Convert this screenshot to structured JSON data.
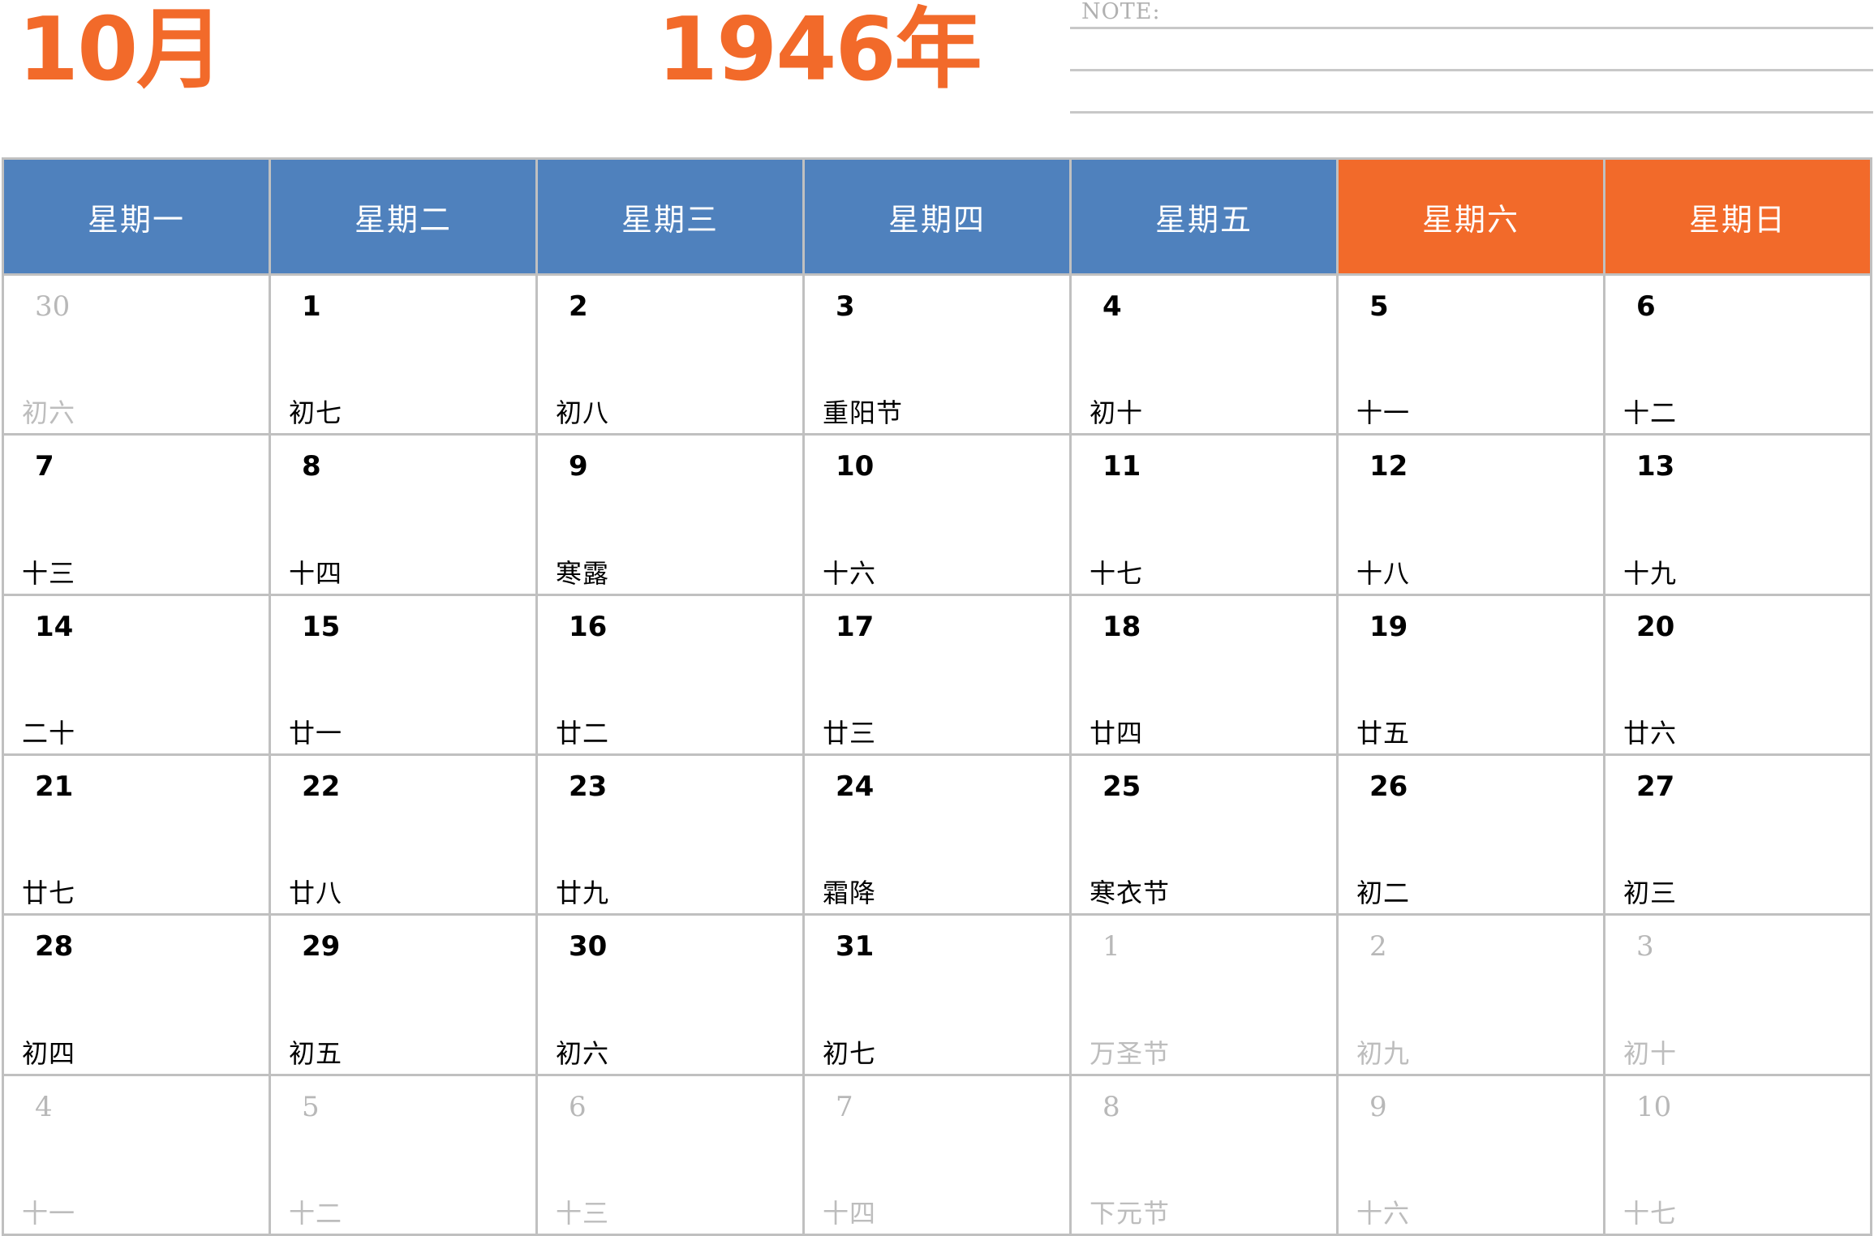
{
  "header": {
    "month": "10月",
    "year": "1946年",
    "note_label": "NOTE:"
  },
  "colors": {
    "accent": "#f26a2a",
    "weekday_header": "#4f81bd",
    "weekend_header": "#f26a2a",
    "muted_text": "#b8b8b8",
    "grid_line": "#c0c0c0"
  },
  "weekdays": [
    "星期一",
    "星期二",
    "星期三",
    "星期四",
    "星期五",
    "星期六",
    "星期日"
  ],
  "weeks": [
    [
      {
        "day": "30",
        "lunar": "初六",
        "muted": true
      },
      {
        "day": "1",
        "lunar": "初七",
        "muted": false
      },
      {
        "day": "2",
        "lunar": "初八",
        "muted": false
      },
      {
        "day": "3",
        "lunar": "重阳节",
        "muted": false
      },
      {
        "day": "4",
        "lunar": "初十",
        "muted": false
      },
      {
        "day": "5",
        "lunar": "十一",
        "muted": false
      },
      {
        "day": "6",
        "lunar": "十二",
        "muted": false
      }
    ],
    [
      {
        "day": "7",
        "lunar": "十三",
        "muted": false
      },
      {
        "day": "8",
        "lunar": "十四",
        "muted": false
      },
      {
        "day": "9",
        "lunar": "寒露",
        "muted": false
      },
      {
        "day": "10",
        "lunar": "十六",
        "muted": false
      },
      {
        "day": "11",
        "lunar": "十七",
        "muted": false
      },
      {
        "day": "12",
        "lunar": "十八",
        "muted": false
      },
      {
        "day": "13",
        "lunar": "十九",
        "muted": false
      }
    ],
    [
      {
        "day": "14",
        "lunar": "二十",
        "muted": false
      },
      {
        "day": "15",
        "lunar": "廿一",
        "muted": false
      },
      {
        "day": "16",
        "lunar": "廿二",
        "muted": false
      },
      {
        "day": "17",
        "lunar": "廿三",
        "muted": false
      },
      {
        "day": "18",
        "lunar": "廿四",
        "muted": false
      },
      {
        "day": "19",
        "lunar": "廿五",
        "muted": false
      },
      {
        "day": "20",
        "lunar": "廿六",
        "muted": false
      }
    ],
    [
      {
        "day": "21",
        "lunar": "廿七",
        "muted": false
      },
      {
        "day": "22",
        "lunar": "廿八",
        "muted": false
      },
      {
        "day": "23",
        "lunar": "廿九",
        "muted": false
      },
      {
        "day": "24",
        "lunar": "霜降",
        "muted": false
      },
      {
        "day": "25",
        "lunar": "寒衣节",
        "muted": false
      },
      {
        "day": "26",
        "lunar": "初二",
        "muted": false
      },
      {
        "day": "27",
        "lunar": "初三",
        "muted": false
      }
    ],
    [
      {
        "day": "28",
        "lunar": "初四",
        "muted": false
      },
      {
        "day": "29",
        "lunar": "初五",
        "muted": false
      },
      {
        "day": "30",
        "lunar": "初六",
        "muted": false
      },
      {
        "day": "31",
        "lunar": "初七",
        "muted": false
      },
      {
        "day": "1",
        "lunar": "万圣节",
        "muted": true
      },
      {
        "day": "2",
        "lunar": "初九",
        "muted": true
      },
      {
        "day": "3",
        "lunar": "初十",
        "muted": true
      }
    ],
    [
      {
        "day": "4",
        "lunar": "十一",
        "muted": true
      },
      {
        "day": "5",
        "lunar": "十二",
        "muted": true
      },
      {
        "day": "6",
        "lunar": "十三",
        "muted": true
      },
      {
        "day": "7",
        "lunar": "十四",
        "muted": true
      },
      {
        "day": "8",
        "lunar": "下元节",
        "muted": true
      },
      {
        "day": "9",
        "lunar": "十六",
        "muted": true
      },
      {
        "day": "10",
        "lunar": "十七",
        "muted": true
      }
    ]
  ]
}
